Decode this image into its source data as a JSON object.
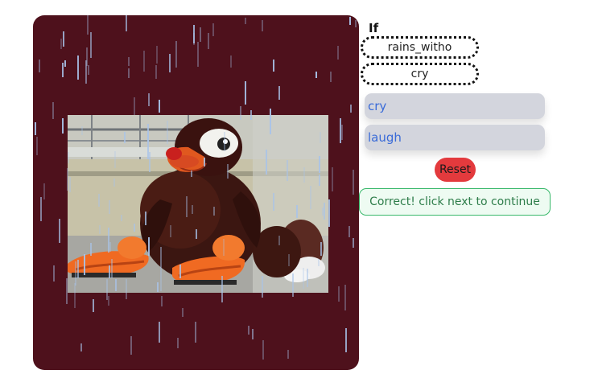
{
  "puzzle": {
    "prompt_label": "If",
    "slots": [
      "rains_witho",
      "cry"
    ],
    "choices": [
      "cry",
      "laugh"
    ],
    "reset_label": "Reset",
    "feedback": "Correct! click next to continue"
  },
  "scene": {
    "background_color": "#4e111c",
    "rain_color": "#a9c4ea",
    "image": "photo of a maroon and orange turkey mascot sitting on the ground"
  },
  "colors": {
    "choice_bg": "#d3d5dd",
    "choice_text": "#3a6bd8",
    "reset_bg": "#e33a3d",
    "feedback_border": "#38b86a",
    "feedback_text": "#2e7d4a"
  }
}
